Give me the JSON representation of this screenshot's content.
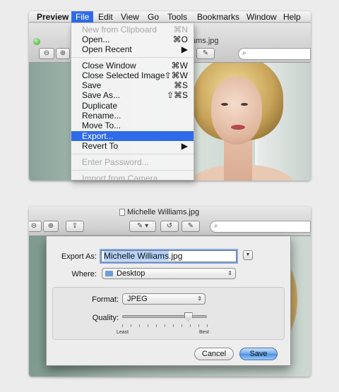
{
  "menubar": {
    "app": "Preview",
    "items": [
      "File",
      "Edit",
      "View",
      "Go",
      "Tools",
      "Bookmarks",
      "Window",
      "Help"
    ]
  },
  "top_window": {
    "title_fragment": "ams.jpg"
  },
  "file_menu": {
    "items": [
      {
        "label": "New from Clipboard",
        "shortcut": "⌘N",
        "disabled": true
      },
      {
        "label": "Open...",
        "shortcut": "⌘O"
      },
      {
        "label": "Open Recent",
        "shortcut": "▶"
      },
      {
        "label": "Close Window",
        "shortcut": "⌘W"
      },
      {
        "label": "Close Selected Image",
        "shortcut": "⇧⌘W"
      },
      {
        "label": "Save",
        "shortcut": "⌘S"
      },
      {
        "label": "Save As...",
        "shortcut": "⇧⌘S"
      },
      {
        "label": "Duplicate",
        "shortcut": ""
      },
      {
        "label": "Rename...",
        "shortcut": ""
      },
      {
        "label": "Move To...",
        "shortcut": ""
      },
      {
        "label": "Export...",
        "shortcut": "",
        "highlighted": true
      },
      {
        "label": "Revert To",
        "shortcut": "▶"
      },
      {
        "label": "Enter Password...",
        "shortcut": "",
        "disabled": true
      },
      {
        "label": "Import from Camera...",
        "shortcut": "",
        "disabled": true
      }
    ]
  },
  "bottom_window": {
    "title": "Michelle Williams.jpg"
  },
  "export_sheet": {
    "export_as_label": "Export As:",
    "filename_base": "Michelle Williams",
    "filename_ext": ".jpg",
    "where_label": "Where:",
    "where_value": "Desktop",
    "format_label": "Format:",
    "format_value": "JPEG",
    "quality_label": "Quality:",
    "quality_level": 0.78,
    "least_label": "Least",
    "best_label": "Best",
    "cancel_label": "Cancel",
    "save_label": "Save"
  },
  "colors": {
    "highlight": "#2f6be8",
    "primary_button": "#5a9be6"
  }
}
